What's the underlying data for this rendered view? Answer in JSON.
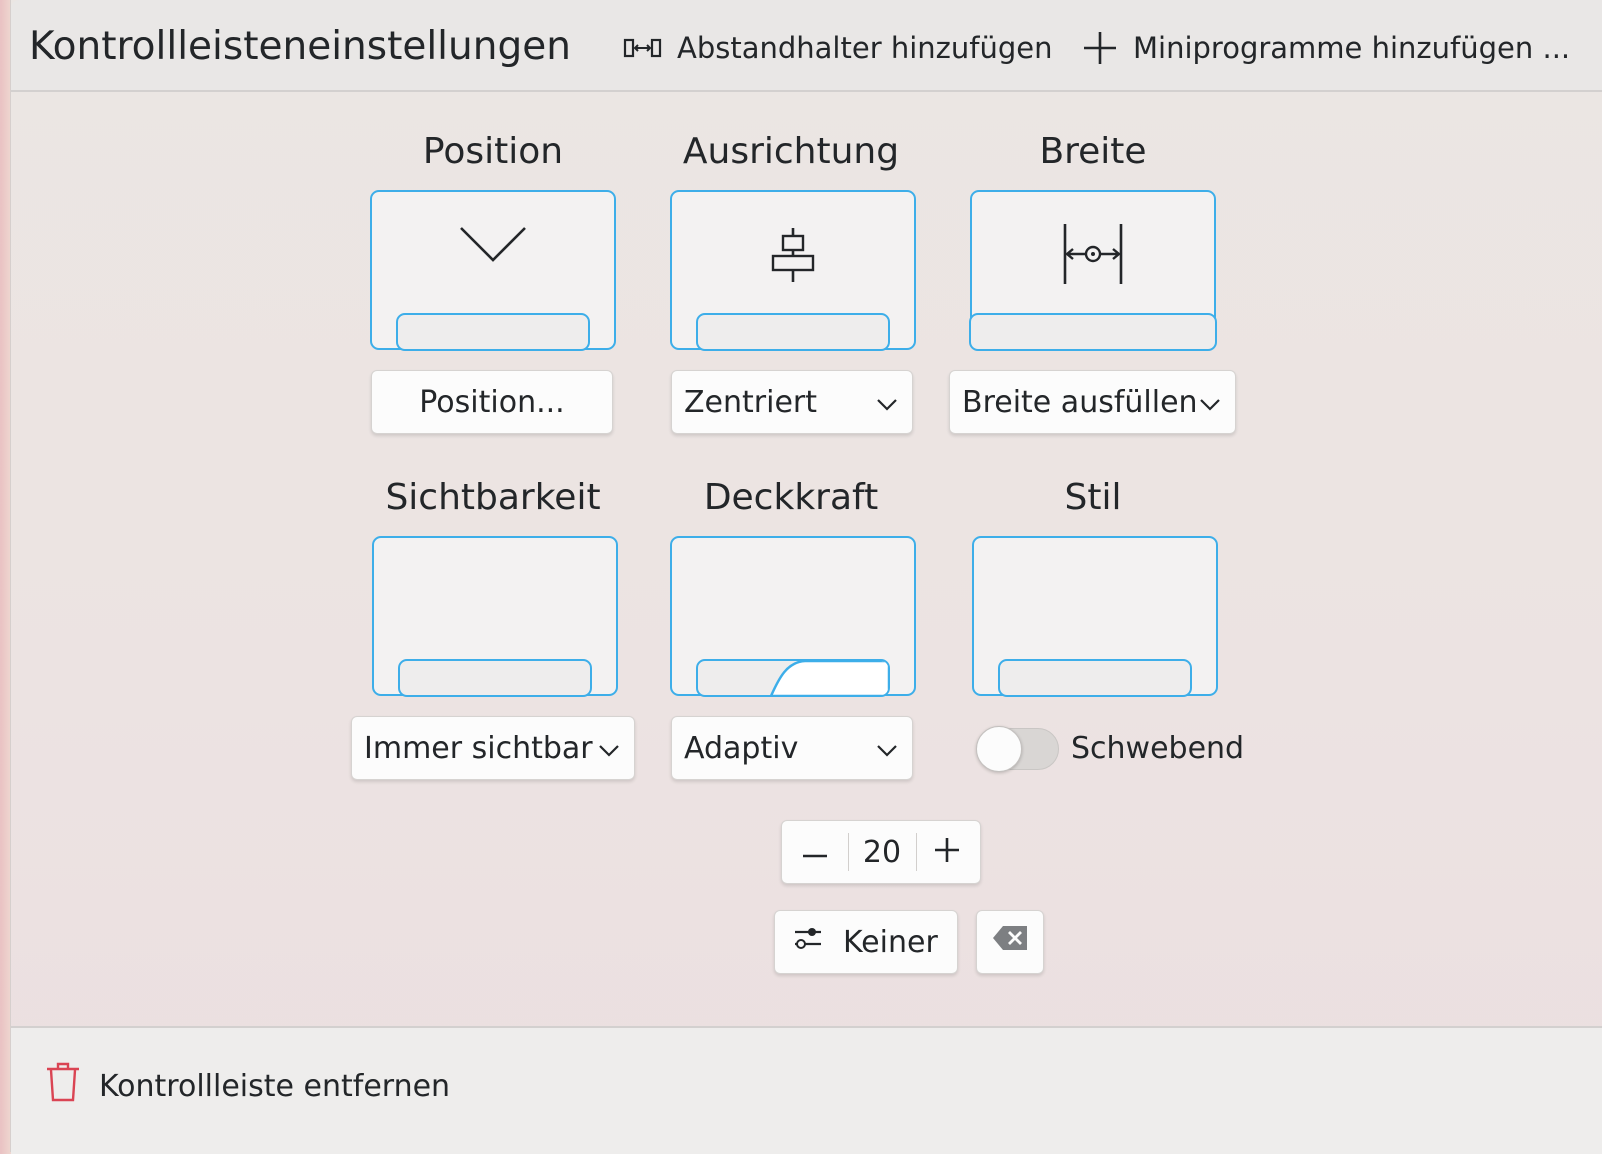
{
  "header": {
    "title": "Kontrollleisteneinstellungen",
    "add_spacer_label": "Abstandhalter hinzufügen",
    "add_widgets_label": "Miniprogramme hinzufügen ..."
  },
  "groups": {
    "position": {
      "title": "Position",
      "button_label": "Position..."
    },
    "alignment": {
      "title": "Ausrichtung",
      "selected": "Zentriert"
    },
    "width": {
      "title": "Breite",
      "selected": "Breite ausfüllen"
    },
    "visibility": {
      "title": "Sichtbarkeit",
      "selected": "Immer sichtbar"
    },
    "opacity": {
      "title": "Deckkraft",
      "selected": "Adaptiv"
    },
    "style": {
      "title": "Stil",
      "toggle_label": "Schwebend",
      "toggle_on": false
    }
  },
  "height_spinbox": {
    "value": "20"
  },
  "shortcut": {
    "label": "Keiner"
  },
  "footer": {
    "remove_label": "Kontrollleiste entfernen"
  },
  "colors": {
    "accent": "#3daee9",
    "danger": "#da4453"
  }
}
